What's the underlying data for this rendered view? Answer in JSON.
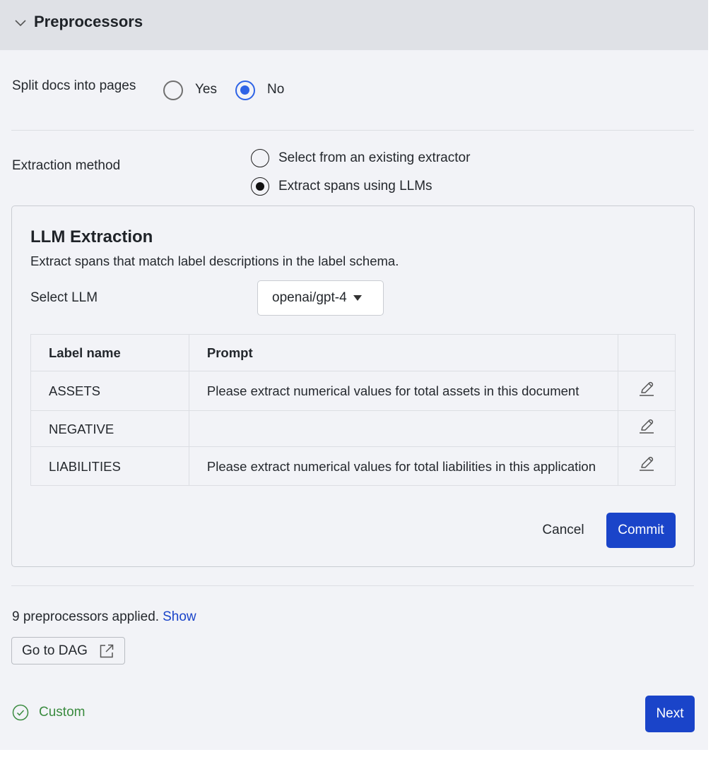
{
  "header": {
    "title": "Preprocessors",
    "collapse_icon": "chevron-down-icon"
  },
  "split_docs": {
    "label": "Split docs into pages",
    "options": [
      {
        "label": "Yes",
        "selected": false
      },
      {
        "label": "No",
        "selected": true
      }
    ]
  },
  "extraction_method": {
    "label": "Extraction method",
    "options": [
      {
        "label": "Select from an existing extractor",
        "selected": false
      },
      {
        "label": "Extract spans using LLMs",
        "selected": true
      }
    ]
  },
  "llm_extraction": {
    "title": "LLM Extraction",
    "description": "Extract spans that match label descriptions in the label schema.",
    "select_llm_label": "Select LLM",
    "selected_llm": "openai/gpt-4",
    "table": {
      "columns": [
        "Label name",
        "Prompt",
        ""
      ],
      "rows": [
        {
          "label": "ASSETS",
          "prompt": "Please extract numerical values for total assets in this document",
          "action_icon": "edit-icon"
        },
        {
          "label": "NEGATIVE",
          "prompt": "",
          "action_icon": "edit-icon"
        },
        {
          "label": "LIABILITIES",
          "prompt": "Please extract numerical values for total liabilities in this application",
          "action_icon": "edit-icon"
        }
      ]
    },
    "cancel_label": "Cancel",
    "commit_label": "Commit"
  },
  "preprocessors": {
    "applied_text": "9 preprocessors applied.",
    "show_link": "Show",
    "dag_button": "Go to DAG",
    "dag_icon": "external-link-icon"
  },
  "footer": {
    "status_text": "Custom",
    "status_icon": "check-circle-icon",
    "next_label": "Next"
  },
  "colors": {
    "primary": "#1a44c9",
    "radio_selected": "#2e63e6",
    "success": "#3a8b3f",
    "header_bg": "#dfe1e6",
    "panel_bg": "#f2f3f7"
  }
}
